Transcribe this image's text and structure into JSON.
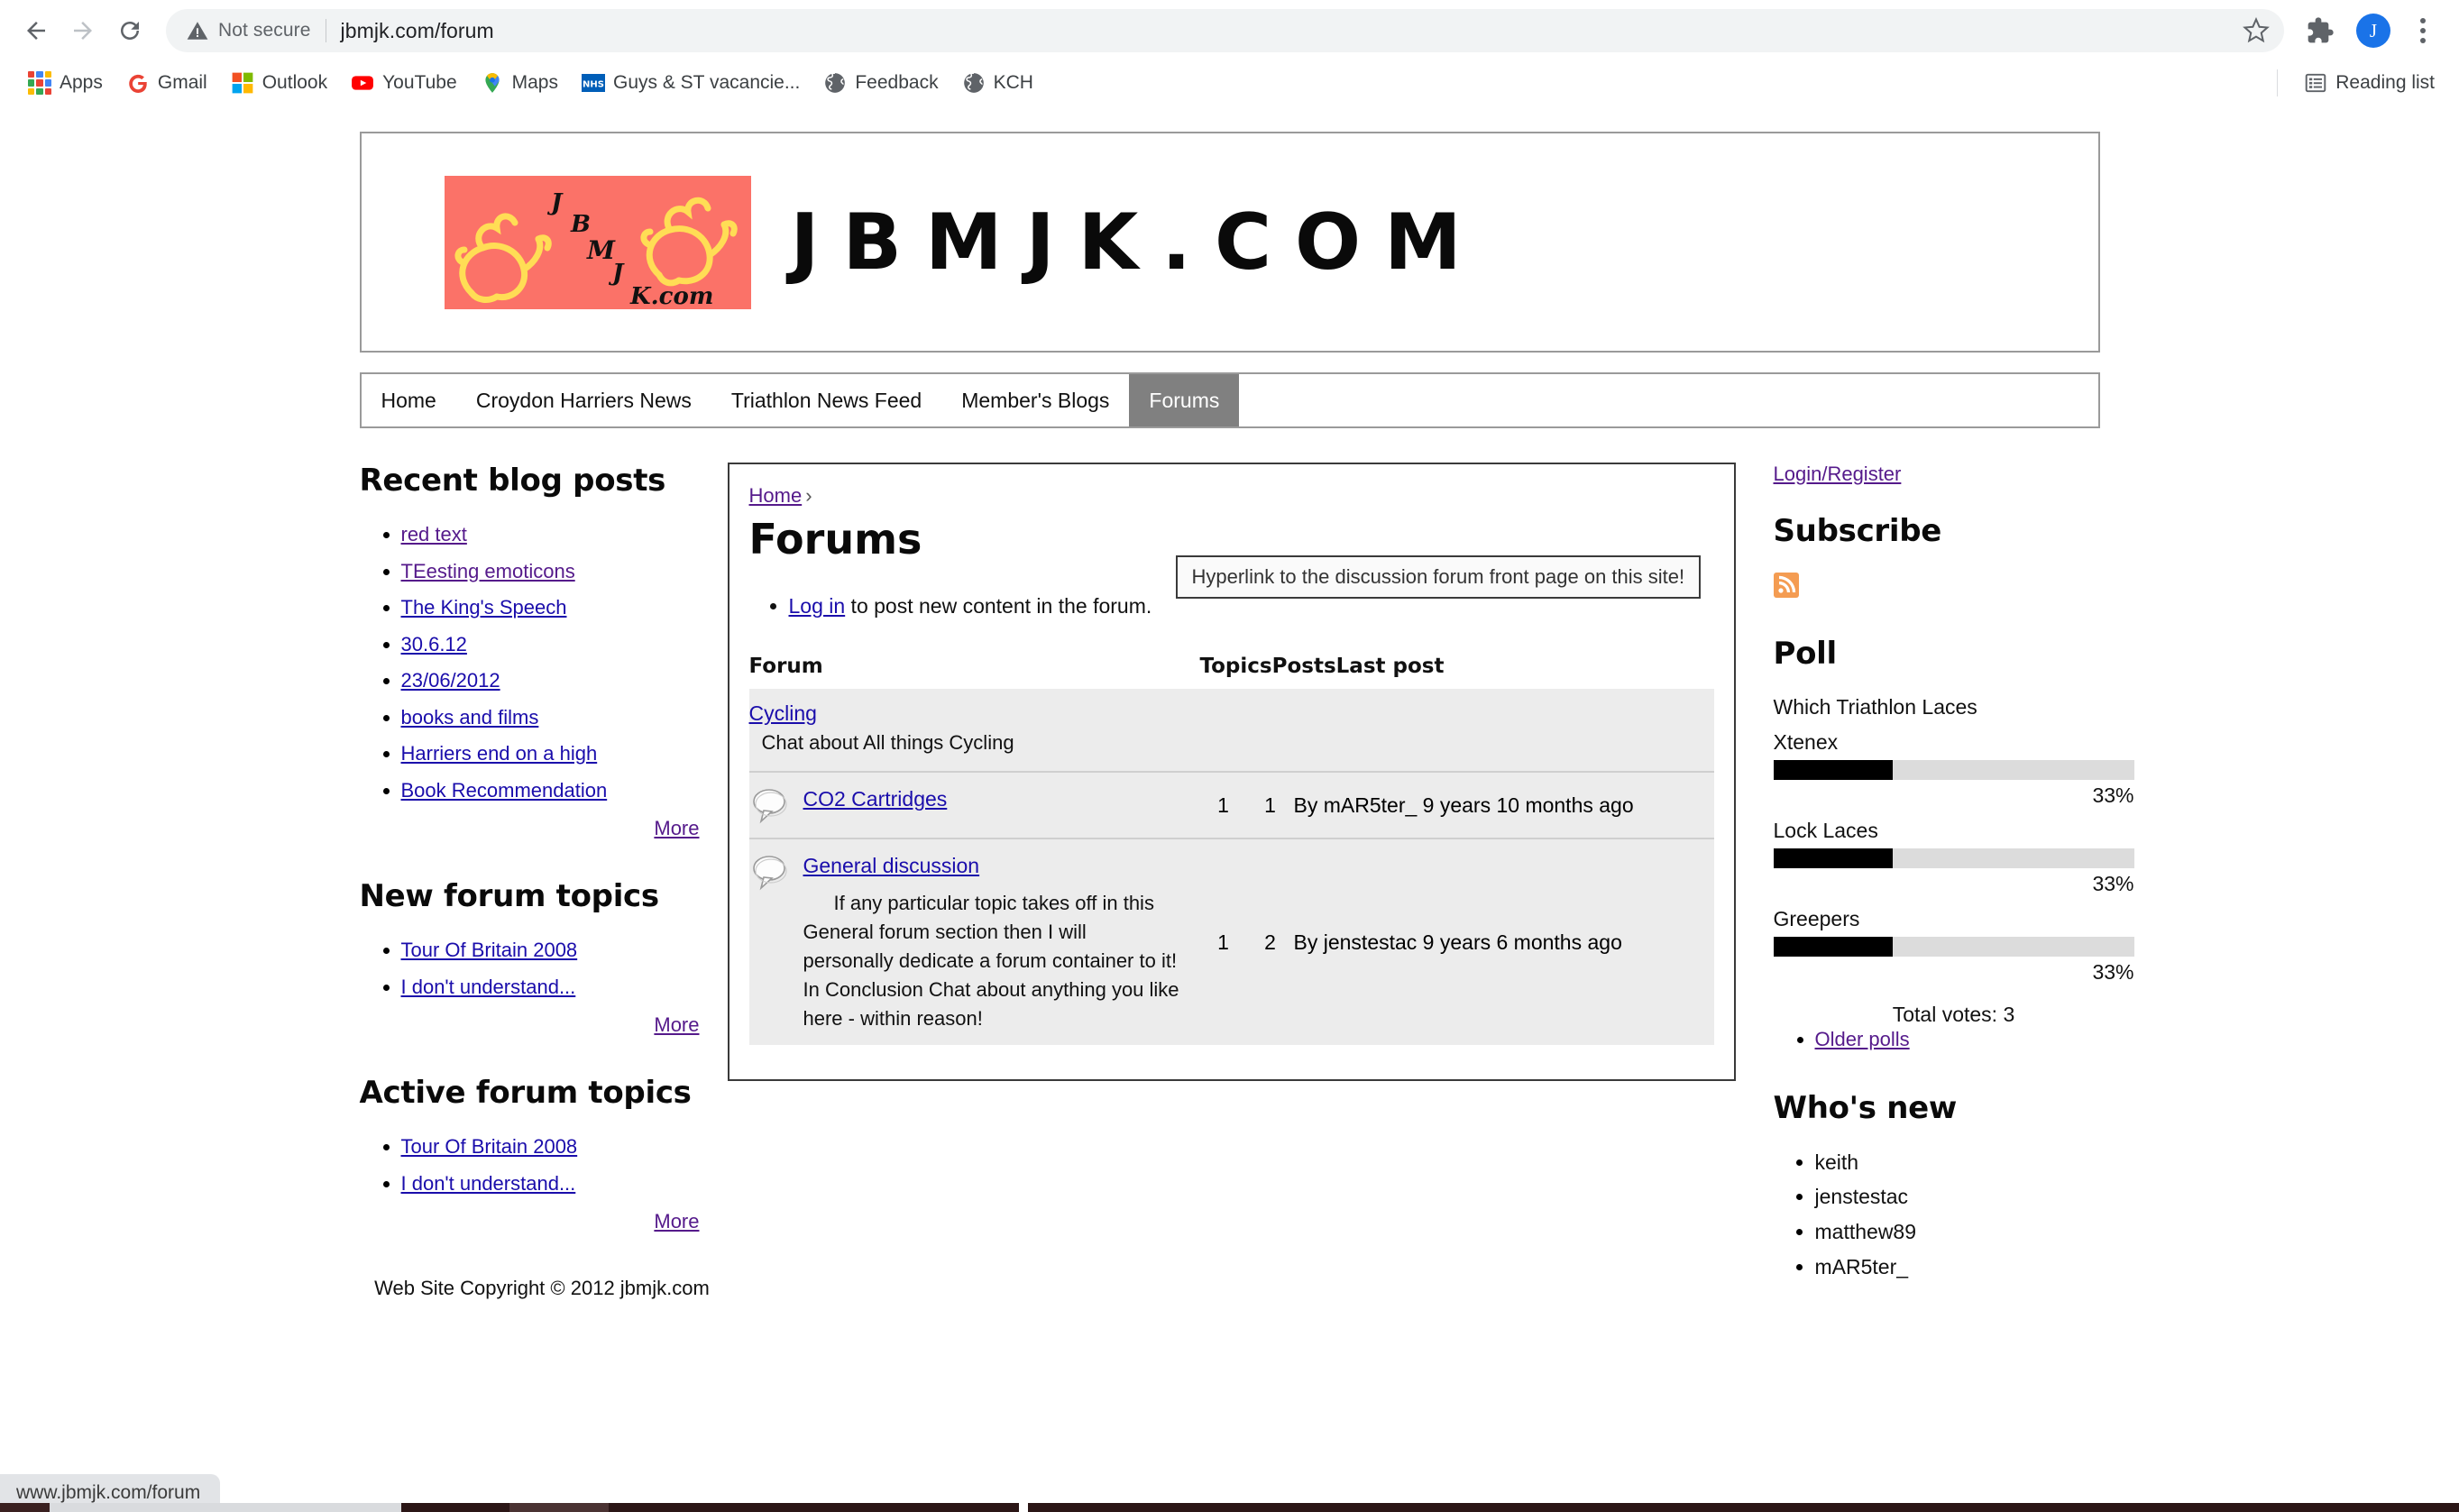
{
  "browser": {
    "nav": {
      "back": "back-arrow",
      "forward": "forward-arrow",
      "reload": "reload"
    },
    "omnibox": {
      "security_label": "Not secure",
      "url": "jbmjk.com/forum",
      "warning_icon": "warning-triangle-icon",
      "star_icon": "star-icon"
    },
    "profile_initial": "J",
    "bookmarks": [
      {
        "label": "Apps",
        "icon": "apps-grid-icon"
      },
      {
        "label": "Gmail",
        "icon": "gmail-icon"
      },
      {
        "label": "Outlook",
        "icon": "outlook-icon"
      },
      {
        "label": "YouTube",
        "icon": "youtube-icon"
      },
      {
        "label": "Maps",
        "icon": "maps-pin-icon"
      },
      {
        "label": "Guys & ST vacancie...",
        "icon": "nhs-icon"
      },
      {
        "label": "Feedback",
        "icon": "globe-icon"
      },
      {
        "label": "KCH",
        "icon": "globe-icon"
      }
    ],
    "reading_list": {
      "label": "Reading list",
      "icon": "reading-list-icon"
    },
    "status_url": "www.jbmjk.com/forum"
  },
  "site": {
    "banner_title": "JBMJK.COM",
    "logo_alt": "JBMJK flames logo",
    "nav": [
      {
        "label": "Home",
        "active": false
      },
      {
        "label": "Croydon Harriers News",
        "active": false
      },
      {
        "label": "Triathlon News Feed",
        "active": false
      },
      {
        "label": "Member's Blogs",
        "active": false
      },
      {
        "label": "Forums",
        "active": true
      }
    ],
    "tooltip": "Hyperlink to the discussion forum front page on this site!",
    "footer": "Web Site Copyright © 2012 jbmjk.com"
  },
  "left": {
    "recent_blog_posts": {
      "title": "Recent blog posts",
      "items": [
        {
          "label": "red text",
          "visited": true
        },
        {
          "label": "TEesting emoticons",
          "visited": true
        },
        {
          "label": "The King's Speech",
          "visited": false
        },
        {
          "label": "30.6.12",
          "visited": false
        },
        {
          "label": "23/06/2012",
          "visited": false
        },
        {
          "label": "books and films",
          "visited": false
        },
        {
          "label": "Harriers end on a high",
          "visited": false
        },
        {
          "label": "Book Recommendation",
          "visited": false
        }
      ],
      "more": "More"
    },
    "new_forum_topics": {
      "title": "New forum topics",
      "items": [
        {
          "label": "Tour Of Britain 2008"
        },
        {
          "label": "I don't understand..."
        }
      ],
      "more": "More"
    },
    "active_forum_topics": {
      "title": "Active forum topics",
      "items": [
        {
          "label": "Tour Of Britain 2008"
        },
        {
          "label": "I don't understand..."
        }
      ],
      "more": "More"
    }
  },
  "main": {
    "breadcrumb_home": "Home",
    "breadcrumb_sep": "›",
    "title": "Forums",
    "login_link": "Log in",
    "login_rest": " to post new content in the forum.",
    "table": {
      "headers": {
        "forum": "Forum",
        "topics": "Topics",
        "posts": "Posts",
        "last_post": "Last post"
      },
      "categories": [
        {
          "name": "Cycling",
          "description": "Chat about All things Cycling",
          "forums": [
            {
              "name": "CO2 Cartridges",
              "description": "",
              "topics": "1",
              "posts": "1",
              "last_post": "By mAR5ter_ 9 years 10 months ago"
            },
            {
              "name": "General discussion",
              "description": "If any particular topic takes off in this General forum section then I will personally dedicate a forum container to it! In Conclusion Chat about anything you like here - within reason!",
              "topics": "1",
              "posts": "2",
              "last_post": "By jenstestac 9 years 6 months ago"
            }
          ]
        }
      ]
    }
  },
  "right": {
    "login_register": "Login/Register",
    "subscribe": {
      "title": "Subscribe",
      "icon": "rss-feed-icon"
    },
    "poll": {
      "title": "Poll",
      "question": "Which Triathlon Laces",
      "options": [
        {
          "label": "Xtenex",
          "percent": "33%",
          "value": 33
        },
        {
          "label": "Lock Laces",
          "percent": "33%",
          "value": 33
        },
        {
          "label": "Greepers",
          "percent": "33%",
          "value": 33
        }
      ],
      "total_votes": "Total votes: 3",
      "older_polls": "Older polls"
    },
    "whos_new": {
      "title": "Who's new",
      "users": [
        "keith",
        "jenstestac",
        "matthew89",
        "mAR5ter_"
      ]
    }
  },
  "colors": {
    "accent_blue": "#1a73e8",
    "link_blue": "#1a0dab",
    "link_visited": "#551a8b",
    "nav_active_bg": "#808080",
    "logo_bg": "#fb7268",
    "logo_flame": "#ffdd55",
    "rss_orange": "#f49c52",
    "table_row_bg": "#ececec"
  }
}
